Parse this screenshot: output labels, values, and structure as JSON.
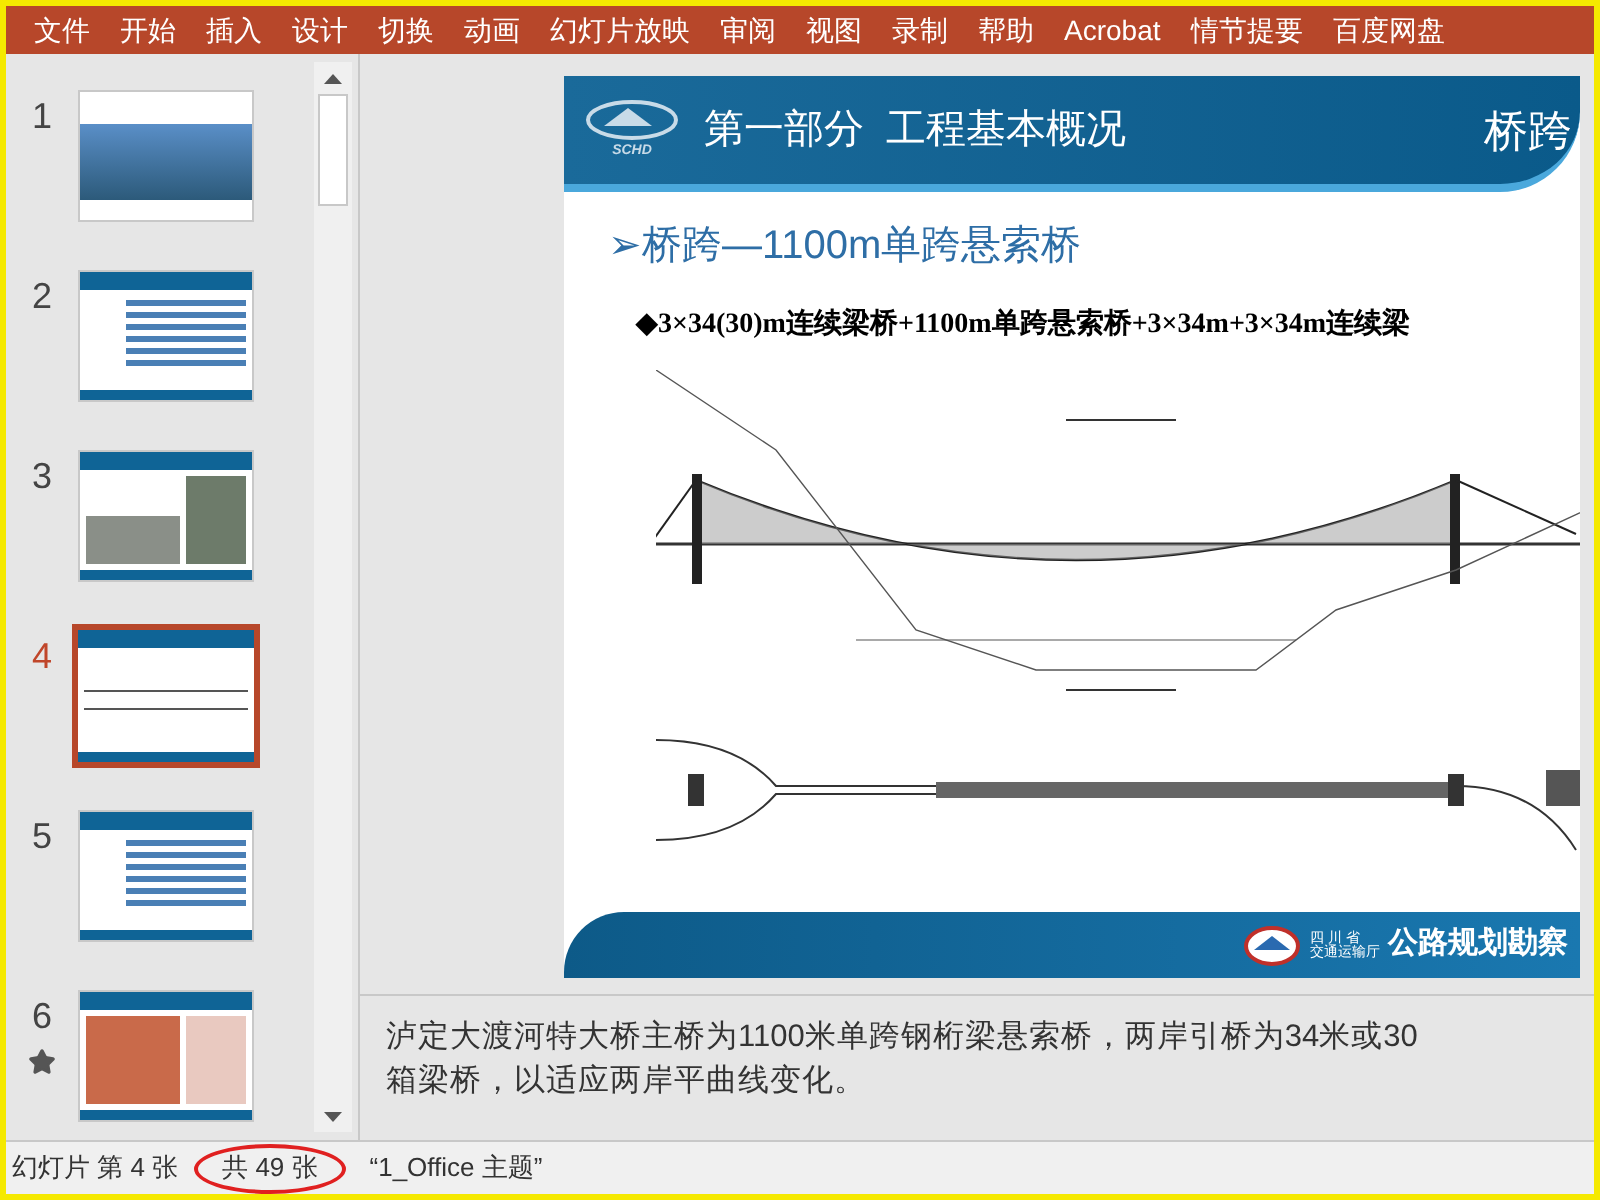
{
  "menu": [
    "文件",
    "开始",
    "插入",
    "设计",
    "切换",
    "动画",
    "幻灯片放映",
    "审阅",
    "视图",
    "录制",
    "帮助",
    "Acrobat",
    "情节提要",
    "百度网盘"
  ],
  "slides_panel": {
    "slides": [
      {
        "number": "1",
        "selected": false,
        "animated": false
      },
      {
        "number": "2",
        "selected": false,
        "animated": false
      },
      {
        "number": "3",
        "selected": false,
        "animated": false
      },
      {
        "number": "4",
        "selected": true,
        "animated": false
      },
      {
        "number": "5",
        "selected": false,
        "animated": false
      },
      {
        "number": "6",
        "selected": false,
        "animated": true
      }
    ]
  },
  "slide": {
    "logo_text": "SCHD",
    "section_title": "第一部分  工程基本概况",
    "header_right": "桥跨",
    "heading": "➢桥跨—1100m单跨悬索桥",
    "bullet": "◆3×34(30)m连续梁桥+1100m单跨悬索桥+3×34m+3×34m连续梁",
    "footer": {
      "org_line1": "四 川 省",
      "org_line2": "交通运输厅",
      "org_name": "公路规划勘察"
    }
  },
  "notes": [
    "泸定大渡河特大桥主桥为1100米单跨钢桁梁悬索桥，两岸引桥为34米或30",
    "箱梁桥，以适应两岸平曲线变化。"
  ],
  "status_bar": {
    "slide_position": "幻灯片 第 4 张",
    "slide_count": "共 49 张",
    "theme": "“1_Office 主题”"
  }
}
